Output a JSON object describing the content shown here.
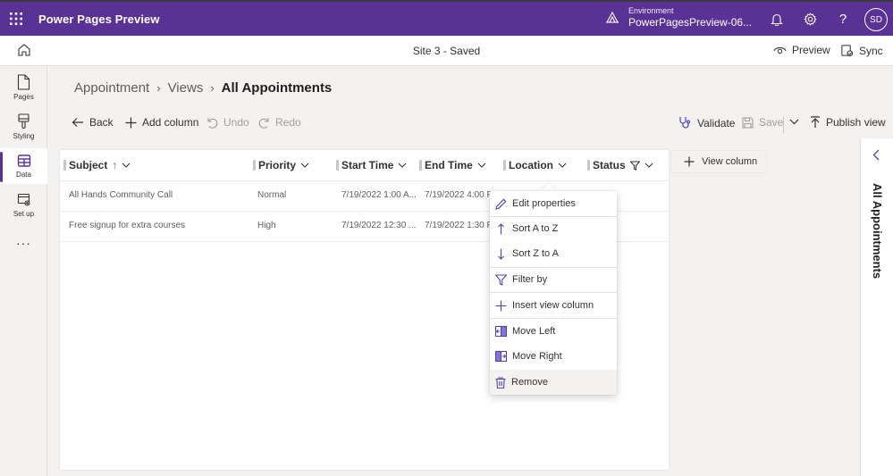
{
  "app": {
    "title": "Power Pages Preview",
    "environment_label": "Environment",
    "environment_name": "PowerPagesPreview-06...",
    "user_initials": "SD"
  },
  "command_bar": {
    "site_status": "Site 3 - Saved",
    "preview_label": "Preview",
    "sync_label": "Sync"
  },
  "rail": {
    "items": [
      {
        "label": "Pages",
        "icon": "page-icon"
      },
      {
        "label": "Styling",
        "icon": "paintbrush-icon"
      },
      {
        "label": "Data",
        "icon": "table-icon"
      },
      {
        "label": "Set up",
        "icon": "setup-icon"
      }
    ],
    "more": "···"
  },
  "breadcrumb": {
    "items": [
      "Appointment",
      "Views"
    ],
    "current": "All Appointments"
  },
  "toolbar": {
    "back": "Back",
    "add_column": "Add column",
    "undo": "Undo",
    "redo": "Redo",
    "validate": "Validate",
    "save": "Save",
    "publish_view": "Publish view"
  },
  "grid": {
    "columns": [
      {
        "label": "Subject",
        "sort": "ascending"
      },
      {
        "label": "Priority"
      },
      {
        "label": "Start Time"
      },
      {
        "label": "End Time"
      },
      {
        "label": "Location"
      },
      {
        "label": "Status",
        "filtered": true
      }
    ],
    "rows": [
      [
        "All Hands Community Call",
        "Normal",
        "7/19/2022 1:00 A...",
        "7/19/2022 4:00 P..."
      ],
      [
        "Free signup for extra courses",
        "High",
        "7/19/2022 12:30 ...",
        "7/19/2022 1:30 P..."
      ]
    ],
    "view_column_label": "View column"
  },
  "context_menu": {
    "items": [
      {
        "label": "Edit properties",
        "icon": "pencil-icon"
      },
      {
        "label": "Sort A to Z",
        "icon": "arrow-up-icon"
      },
      {
        "label": "Sort Z to A",
        "icon": "arrow-down-icon"
      },
      {
        "label": "Filter by",
        "icon": "filter-icon"
      },
      {
        "label": "Insert view column",
        "icon": "plus-icon"
      },
      {
        "label": "Move Left",
        "icon": "move-left-icon"
      },
      {
        "label": "Move Right",
        "icon": "move-right-icon"
      },
      {
        "label": "Remove",
        "icon": "trash-icon"
      }
    ],
    "hovered": "Remove"
  },
  "side_panel": {
    "title": "All Appointments"
  },
  "colors": {
    "brand": "#5a3296",
    "accent": "#4f3fbd"
  }
}
